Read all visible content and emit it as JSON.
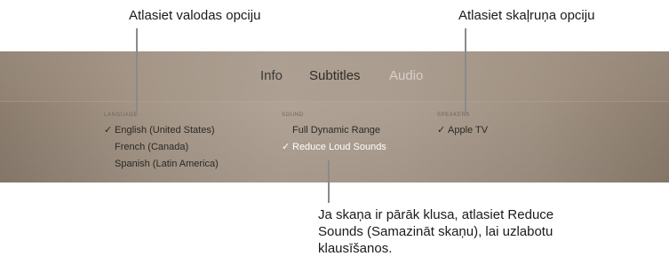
{
  "callouts": {
    "language": "Atlasiet valodas opciju",
    "speakers": "Atlasiet skaļruņa opciju",
    "sound": "Ja skaņa ir pārāk klusa, atlasiet Reduce Sounds (Samazināt skaņu), lai uzlabotu klausīšanos."
  },
  "tabs": [
    {
      "label": "Info"
    },
    {
      "label": "Subtitles"
    },
    {
      "label": "Audio"
    }
  ],
  "selected_tab": "Audio",
  "columns": {
    "language": {
      "header": "LANGUAGE",
      "options": [
        {
          "label": "English (United States)",
          "check": "✓"
        },
        {
          "label": "French (Canada)",
          "check": ""
        },
        {
          "label": "Spanish (Latin America)",
          "check": ""
        }
      ]
    },
    "sound": {
      "header": "SOUND",
      "options": [
        {
          "label": "Full Dynamic Range",
          "check": ""
        },
        {
          "label": "Reduce Loud Sounds",
          "check": "✓"
        }
      ]
    },
    "speakers": {
      "header": "SPEAKERS",
      "options": [
        {
          "label": "Apple TV",
          "check": "✓"
        }
      ]
    }
  },
  "colors": {
    "selected_tab_text": "#d7d0c8",
    "highlighted_option_text": "#ffffff",
    "callout_line": "#8a8a8a"
  }
}
